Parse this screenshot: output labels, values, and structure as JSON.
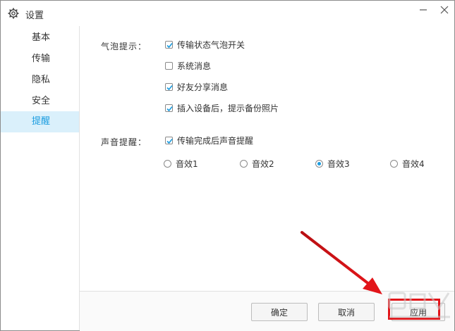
{
  "window": {
    "title": "设置"
  },
  "sidebar": {
    "items": [
      {
        "label": "基本"
      },
      {
        "label": "传输"
      },
      {
        "label": "隐私"
      },
      {
        "label": "安全"
      },
      {
        "label": "提醒",
        "active": true
      }
    ]
  },
  "bubble": {
    "label": "气泡提示：",
    "options": [
      {
        "label": "传输状态气泡开关",
        "checked": true
      },
      {
        "label": "系统消息",
        "checked": false
      },
      {
        "label": "好友分享消息",
        "checked": true
      },
      {
        "label": "插入设备后，提示备份照片",
        "checked": true
      }
    ]
  },
  "sound": {
    "label": "声音提醒：",
    "option": {
      "label": "传输完成后声音提醒",
      "checked": true
    },
    "effects": [
      {
        "label": "音效1",
        "selected": false
      },
      {
        "label": "音效2",
        "selected": false
      },
      {
        "label": "音效3",
        "selected": true
      },
      {
        "label": "音效4",
        "selected": false
      }
    ]
  },
  "footer": {
    "ok_label": "确定",
    "cancel_label": "取消",
    "apply_label": "应用"
  },
  "colors": {
    "accent": "#1a9ce0",
    "active_bg": "#daf0fb",
    "highlight": "#e2151a"
  }
}
